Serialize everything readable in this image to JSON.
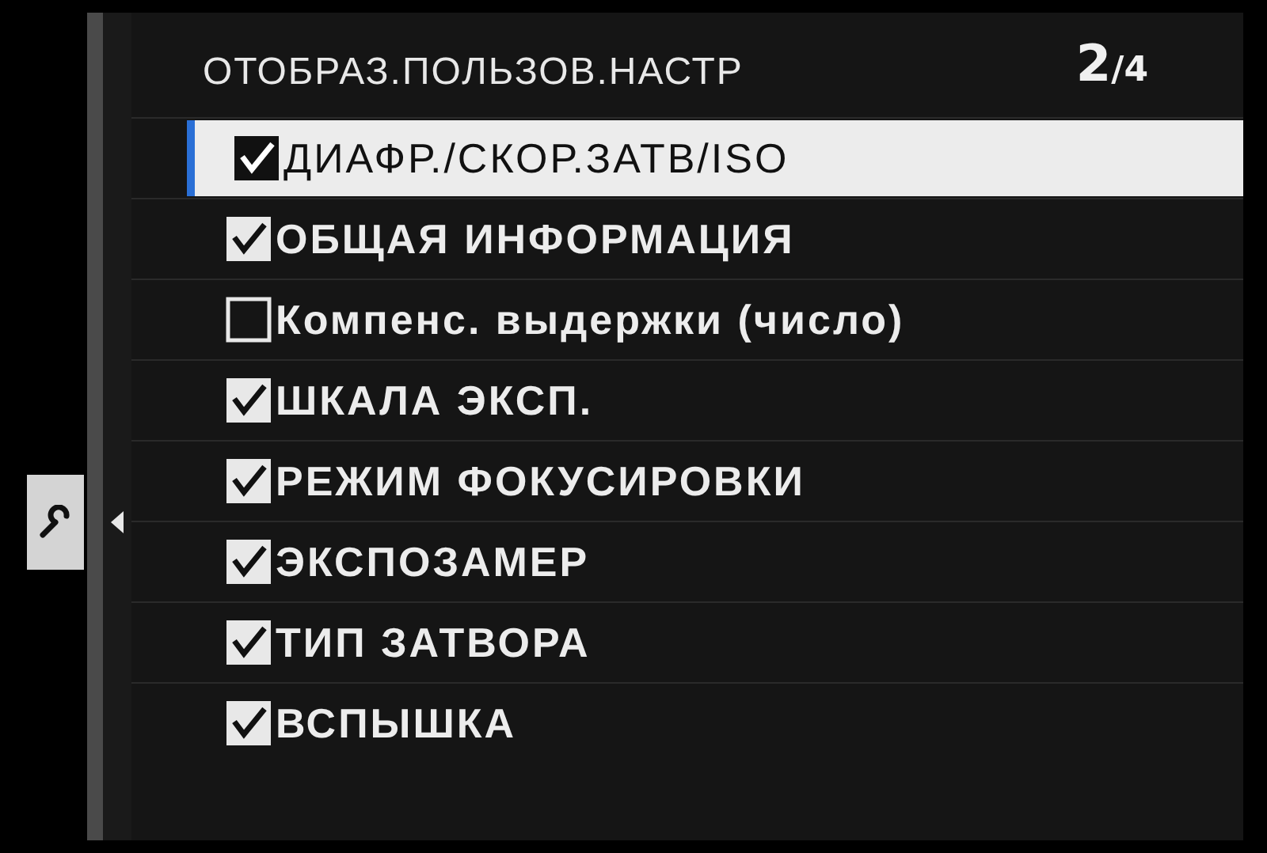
{
  "header": {
    "title": "ОТОБРАЗ.ПОЛЬЗОВ.НАСТР",
    "page": "2",
    "total": "/4"
  },
  "items": [
    {
      "label": "ДИАФР./СКОР.ЗАТВ/ISO",
      "checked": true,
      "selected": true
    },
    {
      "label": "ОБЩАЯ ИНФОРМАЦИЯ",
      "checked": true,
      "selected": false
    },
    {
      "label": "Компенс. выдержки (число)",
      "checked": false,
      "selected": false
    },
    {
      "label": "ШКАЛА ЭКСП.",
      "checked": true,
      "selected": false
    },
    {
      "label": "РЕЖИМ ФОКУСИРОВКИ",
      "checked": true,
      "selected": false
    },
    {
      "label": "ЭКСПОЗАМЕР",
      "checked": true,
      "selected": false
    },
    {
      "label": "ТИП ЗАТВОРА",
      "checked": true,
      "selected": false
    },
    {
      "label": "ВСПЫШКА",
      "checked": true,
      "selected": false
    }
  ]
}
